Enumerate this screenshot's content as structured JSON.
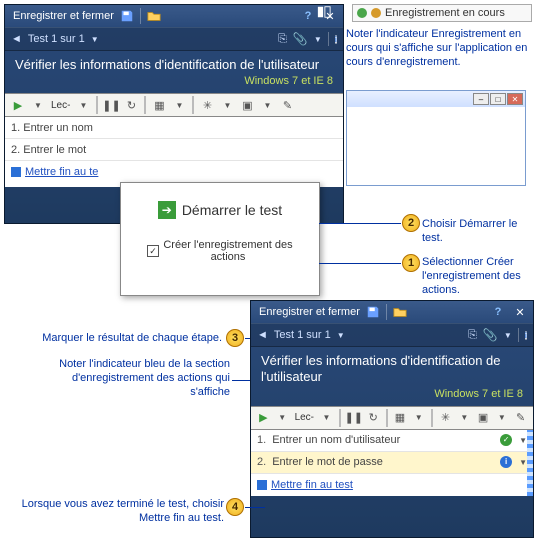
{
  "titlebar": {
    "save_close": "Enregistrer et fermer"
  },
  "subbar": {
    "test_counter": "Test 1 sur 1"
  },
  "main": {
    "title": "Vérifier les informations d'identification de l'utilisateur",
    "env": "Windows 7 et IE 8"
  },
  "toolbar": {
    "lec": "Lec-"
  },
  "steps1": {
    "s1": "1. Entrer un nom",
    "s2": "2. Entrer le mot",
    "end": "Mettre fin au te"
  },
  "popup": {
    "start": "Démarrer le test",
    "checkbox": "Créer l'enregistrement des actions"
  },
  "rec_banner": "Enregistrement en cours",
  "callouts": {
    "c_rec": "Noter l'indicateur Enregistrement en cours qui s'affiche sur l'application en cours d'enregistrement.",
    "c2": "Choisir Démarrer le test.",
    "c1": "Sélectionner Créer l'enregistrement des actions.",
    "c3": "Marquer le résultat de chaque étape.",
    "c_blue": "Noter l'indicateur bleu de la section d'enregistrement des actions qui s'affiche",
    "c4": "Lorsque vous avez terminé le test, choisir Mettre fin au test."
  },
  "steps2": {
    "s1_num": "1.",
    "s1_text": "Entrer un nom d'utilisateur",
    "s2_num": "2.",
    "s2_text": "Entrer le mot de passe",
    "end": "Mettre fin au test"
  }
}
